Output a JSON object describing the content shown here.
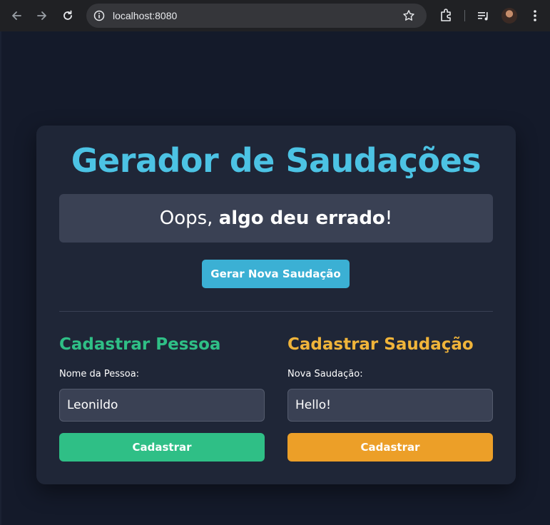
{
  "browser": {
    "url": "localhost:8080",
    "colors": {
      "chrome_bg": "#202124",
      "omnibox_bg": "#35363a"
    }
  },
  "app": {
    "title": "Gerador de Saudações",
    "message": {
      "prefix": "Oops, ",
      "bold": "algo deu errado",
      "suffix": "!"
    },
    "generate_button": "Gerar Nova Saudação",
    "person_form": {
      "title": "Cadastrar Pessoa",
      "label": "Nome da Pessoa:",
      "value": "Leonildo",
      "button": "Cadastrar"
    },
    "greeting_form": {
      "title": "Cadastrar Saudação",
      "label": "Nova Saudação:",
      "value": "Hello!",
      "button": "Cadastrar"
    },
    "colors": {
      "title": "#4cc3e4",
      "generate_button": "#3bb0d4",
      "person_accent": "#2fbf86",
      "greeting_accent": "#f0b43a",
      "greeting_button": "#ec9f28",
      "card_bg": "#1f2637",
      "page_bg": "#141a2a"
    },
    "icons": [
      "back-arrow-icon",
      "forward-arrow-icon",
      "reload-icon",
      "site-info-icon",
      "bookmark-star-icon",
      "extensions-icon",
      "media-controls-icon",
      "profile-avatar",
      "kebab-menu-icon"
    ]
  }
}
